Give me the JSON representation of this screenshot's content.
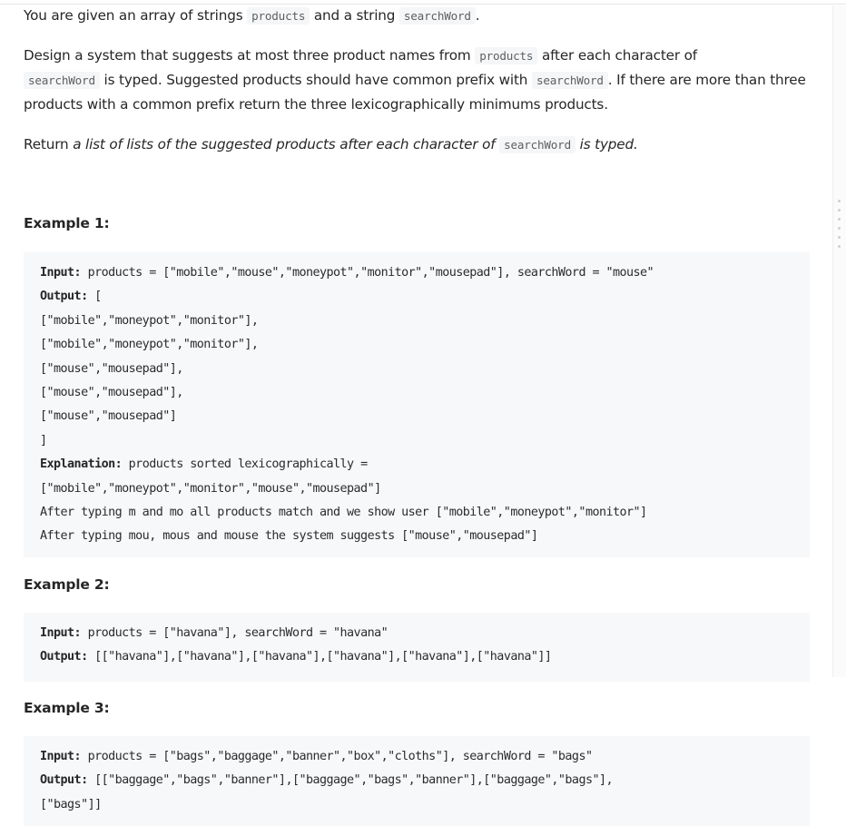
{
  "description": {
    "p1": {
      "t1": "You are given an array of strings ",
      "c1": "products",
      "t2": " and a string ",
      "c2": "searchWord",
      "t3": "."
    },
    "p2": {
      "t1": "Design a system that suggests at most three product names from ",
      "c1": "products",
      "t2": " after each character of ",
      "c2": "searchWord",
      "t3": " is typed. Suggested products should have common prefix with ",
      "c3": "searchWord",
      "t4": ". If there are more than three products with a common prefix return the three lexicographically minimums products."
    },
    "p3": {
      "t1": "Return ",
      "e1": "a list of lists of the suggested products after each character of ",
      "c1": "searchWord",
      "e2": " is typed."
    }
  },
  "examples": [
    {
      "title": "Example 1:",
      "lines": [
        {
          "label": "Input:",
          "text": " products = [\"mobile\",\"mouse\",\"moneypot\",\"monitor\",\"mousepad\"], searchWord = \"mouse\""
        },
        {
          "label": "Output:",
          "text": " ["
        },
        {
          "label": "",
          "text": "[\"mobile\",\"moneypot\",\"monitor\"],"
        },
        {
          "label": "",
          "text": "[\"mobile\",\"moneypot\",\"monitor\"],"
        },
        {
          "label": "",
          "text": "[\"mouse\",\"mousepad\"],"
        },
        {
          "label": "",
          "text": "[\"mouse\",\"mousepad\"],"
        },
        {
          "label": "",
          "text": "[\"mouse\",\"mousepad\"]"
        },
        {
          "label": "",
          "text": "]"
        },
        {
          "label": "Explanation:",
          "text": " products sorted lexicographically ="
        },
        {
          "label": "",
          "text": "[\"mobile\",\"moneypot\",\"monitor\",\"mouse\",\"mousepad\"]"
        },
        {
          "label": "",
          "text": "After typing m and mo all products match and we show user [\"mobile\",\"moneypot\",\"monitor\"]"
        },
        {
          "label": "",
          "text": "After typing mou, mous and mouse the system suggests [\"mouse\",\"mousepad\"]"
        }
      ]
    },
    {
      "title": "Example 2:",
      "lines": [
        {
          "label": "Input:",
          "text": " products = [\"havana\"], searchWord = \"havana\""
        },
        {
          "label": "Output:",
          "text": " [[\"havana\"],[\"havana\"],[\"havana\"],[\"havana\"],[\"havana\"],[\"havana\"]]"
        }
      ]
    },
    {
      "title": "Example 3:",
      "lines": [
        {
          "label": "Input:",
          "text": " products = [\"bags\",\"baggage\",\"banner\",\"box\",\"cloths\"], searchWord = \"bags\""
        },
        {
          "label": "Output:",
          "text": " [[\"baggage\",\"bags\",\"banner\"],[\"baggage\",\"bags\",\"banner\"],[\"baggage\",\"bags\"],"
        },
        {
          "label": "",
          "text": "[\"bags\"]]"
        }
      ]
    }
  ]
}
